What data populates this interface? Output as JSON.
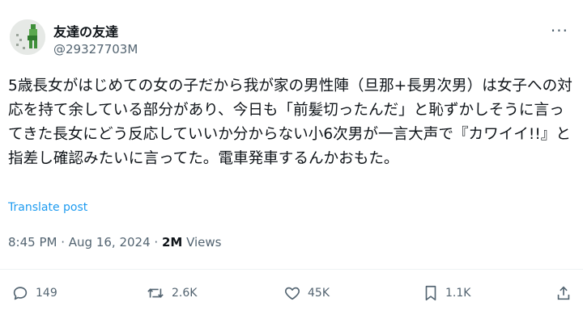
{
  "user": {
    "display_name": "友達の友達",
    "handle": "@29327703M"
  },
  "tweet": {
    "text": "5歳長女がはじめての女の子だから我が家の男性陣（旦那+長男次男）は女子への対応を持て余している部分があり、今日も「前髪切ったんだ」と恥ずかしそうに言ってきた長女にどう反応していいか分からない小6次男が一言大声で『カワイイ!!』と指差し確認みたいに言ってた。電車発車するんかおもた。",
    "translate_label": "Translate post",
    "time": "8:45 PM",
    "separator1": " · ",
    "date": "Aug 16, 2024",
    "separator2": " · ",
    "views_count": "2M",
    "views_label": " Views"
  },
  "actions": {
    "reply": {
      "count": "149",
      "icon": "reply-icon"
    },
    "retweet": {
      "count": "2.6K",
      "icon": "retweet-icon"
    },
    "like": {
      "count": "45K",
      "icon": "heart-icon"
    },
    "bookmark": {
      "count": "1.1K",
      "icon": "bookmark-icon"
    },
    "share": {
      "icon": "share-icon"
    }
  },
  "colors": {
    "text": "#0f1419",
    "muted": "#536471",
    "link": "#1d9bf0"
  }
}
